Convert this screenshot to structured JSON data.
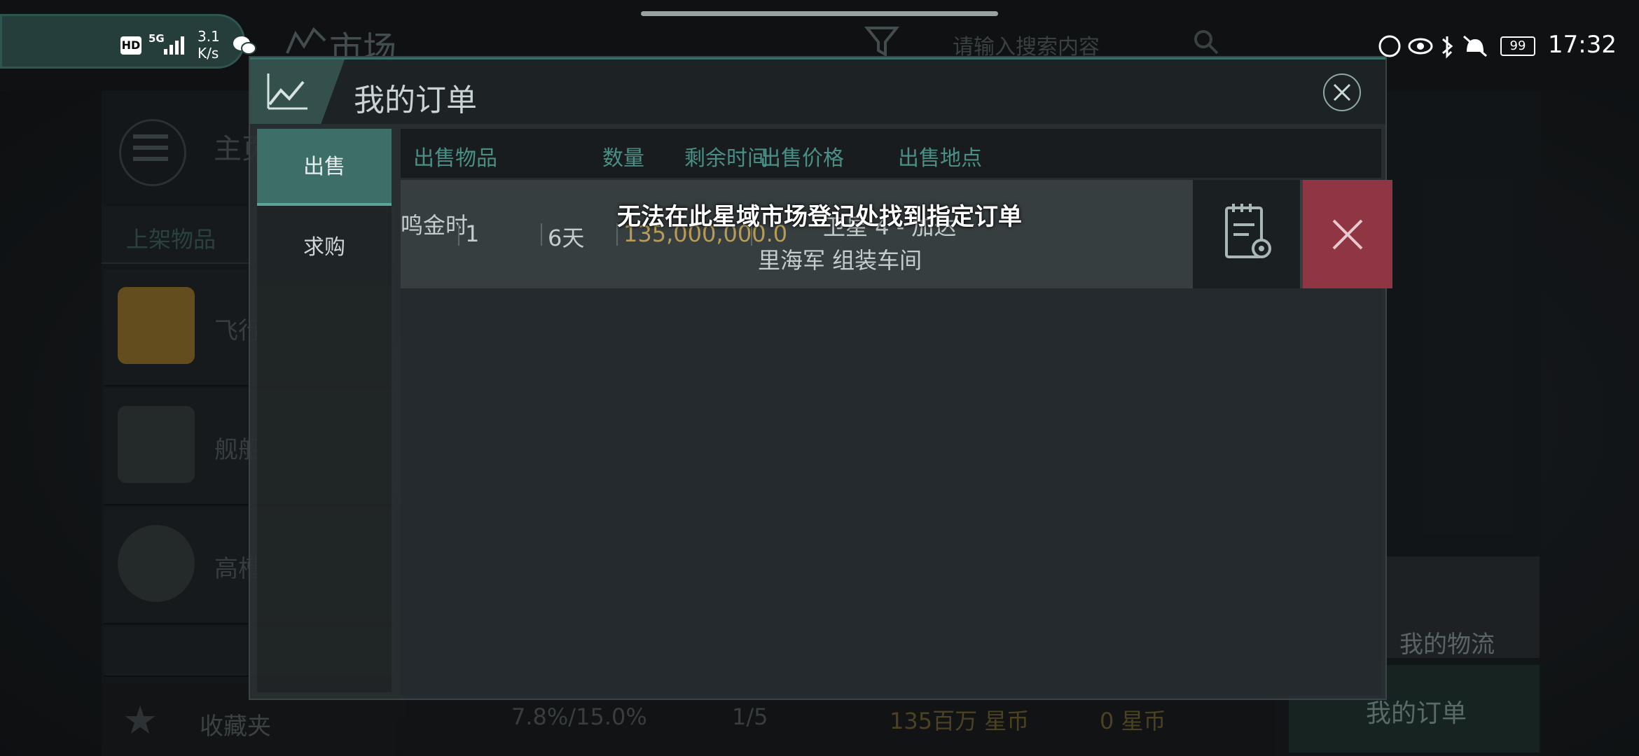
{
  "status_bar": {
    "network_badge": "HD",
    "network_type": "5G",
    "net_speed_value": "3.1",
    "net_speed_unit": "K/s",
    "battery": "99",
    "time": "17:32"
  },
  "background": {
    "title": "市场",
    "search_placeholder": "请输入搜索内容",
    "main_label": "主页",
    "shelf_tab": "上架物品",
    "items": [
      "飞行",
      "舰船",
      "高槽",
      ""
    ],
    "favorites_label": "收藏夹",
    "stats": {
      "tax": "7.8%/15.0%",
      "orders": "1/5",
      "escrow": "135百万 星币",
      "balance": "0 星币"
    },
    "logistics_label": "我的物流",
    "my_orders_button": "我的订单"
  },
  "dialog": {
    "title": "我的订单",
    "tabs": [
      {
        "label": "出售",
        "active": true
      },
      {
        "label": "求购",
        "active": false
      }
    ],
    "columns": [
      "出售物品",
      "数量",
      "剩余时间",
      "出售价格",
      "出售地点"
    ],
    "rows": [
      {
        "item": "鸣金时",
        "quantity": "1",
        "remaining": "6天",
        "price": "135,000,000.0",
        "location_line1": "卫星 4 - 加达",
        "location_line2": "里海军 组装车间"
      }
    ]
  },
  "toast": "无法在此星域市场登记处找到指定订单",
  "colors": {
    "accent": "#4a8f86",
    "tab_active": "#3e6e68",
    "delete": "#8f3544",
    "price": "#b89c55"
  }
}
